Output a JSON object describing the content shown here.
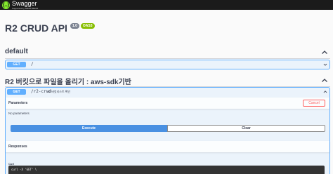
{
  "topbar": {
    "logo_mark": "{..}",
    "logo_name": "Swagger",
    "logo_sub": "Supported by SMARTBEAR"
  },
  "info": {
    "title": "R2 CRUD API",
    "version": "1.0",
    "oas": "OAS3"
  },
  "tags": [
    {
      "name": "default",
      "description": ""
    },
    {
      "name": "R2 버킷으로 파일을 올리기 : aws-sdk기반",
      "description": ""
    }
  ],
  "operations": [
    {
      "method": "GET",
      "path": "/",
      "description": ""
    },
    {
      "method": "GET",
      "path": "/r2-crud",
      "description": "R2 버킷리스트 확인"
    }
  ],
  "parameters": {
    "title": "Parameters",
    "cancel_label": "Cancel",
    "no_params": "No parameters"
  },
  "actions": {
    "execute_label": "Execute",
    "clear_label": "Clear"
  },
  "responses": {
    "title": "Responses",
    "curl_label": "Curl",
    "curl_text": "curl -X 'GET' \\"
  },
  "colors": {
    "get_accent": "#61affe",
    "execute": "#4990e2",
    "cancel": "#ff6060",
    "topbar": "#1b1b1b",
    "oas_badge": "#89bf04"
  }
}
